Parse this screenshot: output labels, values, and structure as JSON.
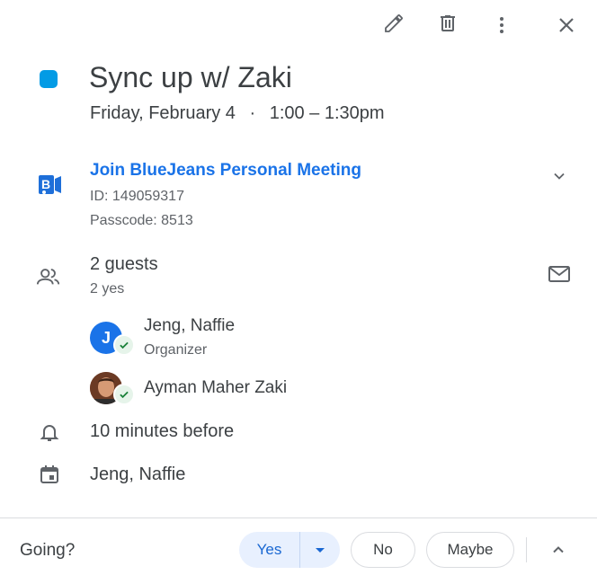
{
  "toolbar": {
    "edit": "edit-icon",
    "delete": "delete-icon",
    "more": "more-vert-icon",
    "close": "close-icon"
  },
  "event": {
    "color": "#039be5",
    "title": "Sync up w/ Zaki",
    "date": "Friday, February 4",
    "separator": "·",
    "time": "1:00 – 1:30pm"
  },
  "conference": {
    "link_label": "Join BlueJeans Personal Meeting",
    "id_line": "ID: 149059317",
    "passcode_line": "Passcode: 8513"
  },
  "guests": {
    "summary": "2 guests",
    "responses": "2 yes",
    "list": [
      {
        "name": "Jeng, Naffie",
        "role": "Organizer",
        "initial": "J"
      },
      {
        "name": "Ayman Maher Zaki",
        "role": ""
      }
    ]
  },
  "reminder": "10 minutes before",
  "calendar_owner": "Jeng, Naffie",
  "footer": {
    "going_label": "Going?",
    "yes_label": "Yes",
    "no_label": "No",
    "maybe_label": "Maybe"
  }
}
